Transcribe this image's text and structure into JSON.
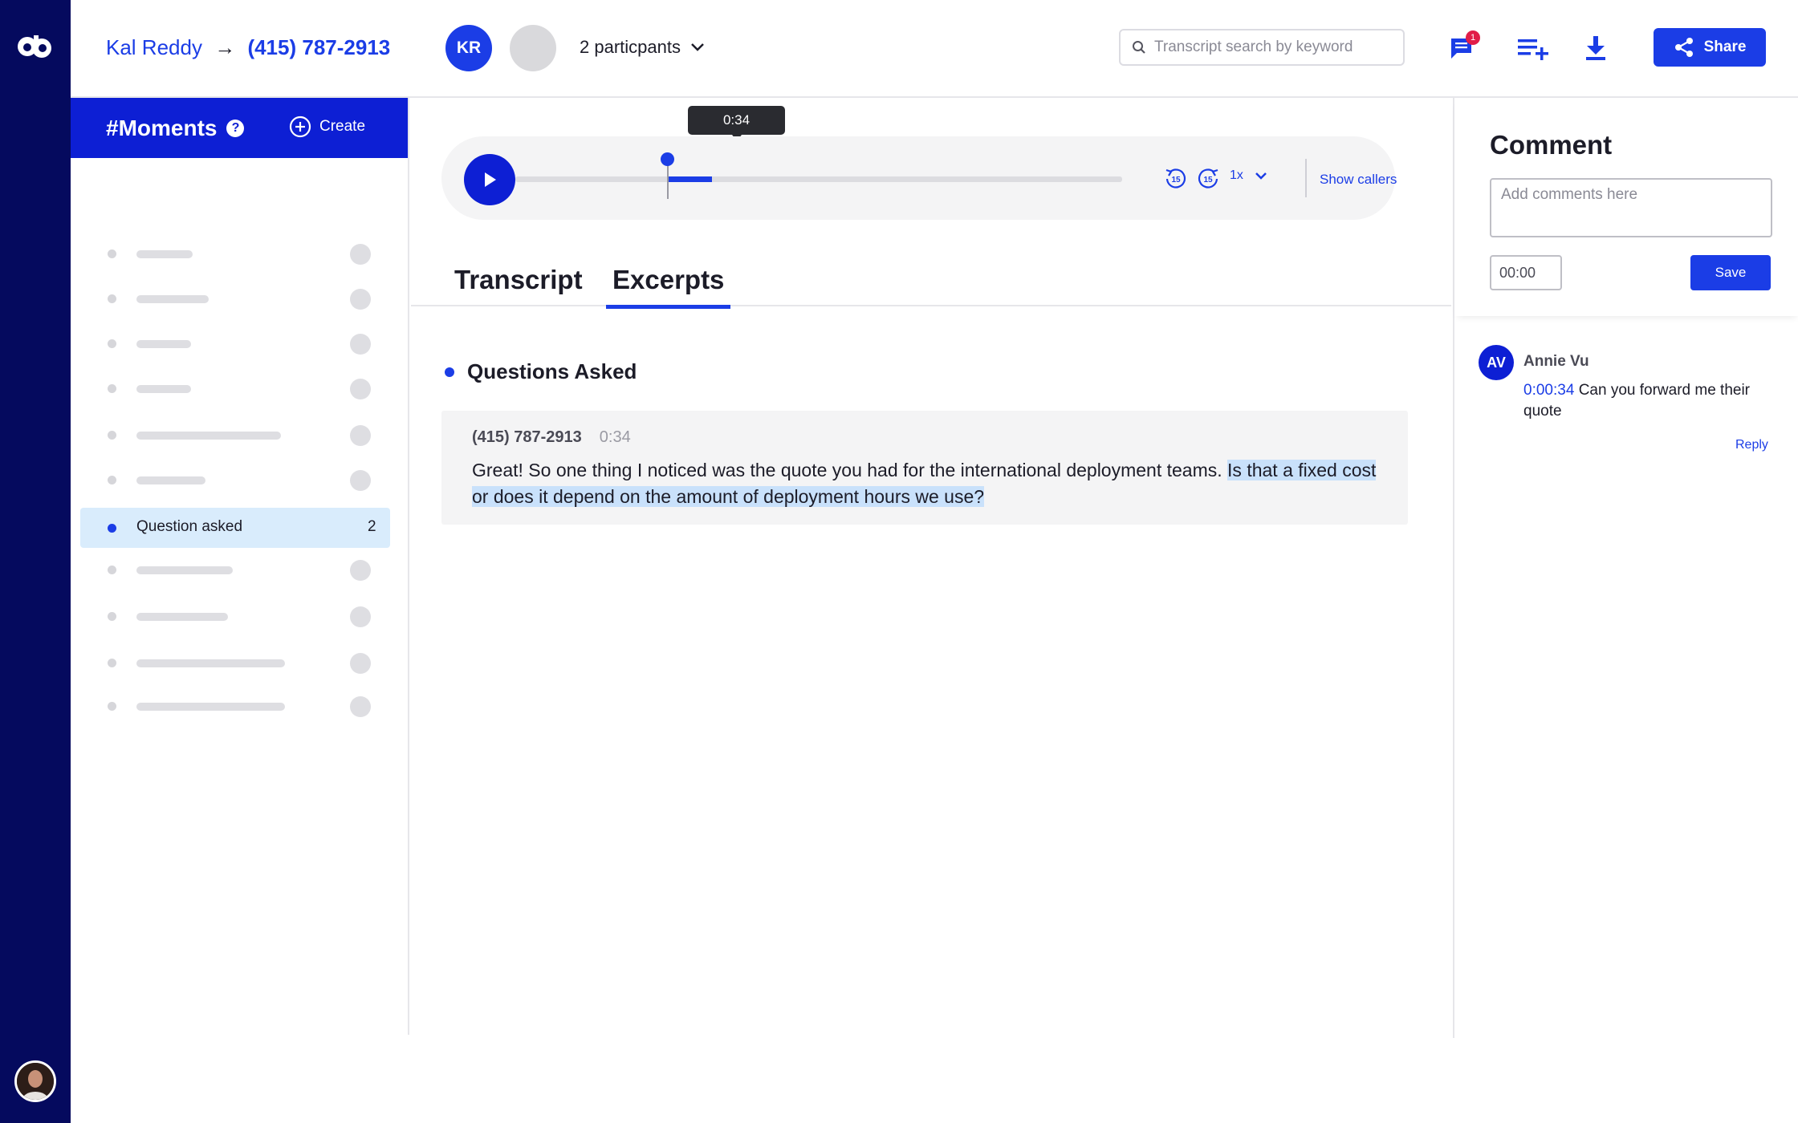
{
  "header": {
    "caller_name": "Kal Reddy",
    "arrow": "→",
    "callee_phone": "(415) 787-2913",
    "participant_initials": "KR",
    "participants_label": "2 particpants",
    "search_placeholder": "Transcript search by keyword",
    "comments_badge": "1",
    "share_label": "Share"
  },
  "moments": {
    "title": "#Moments",
    "help_glyph": "?",
    "create_label": "Create",
    "active_item": {
      "label": "Question asked",
      "count": "2"
    }
  },
  "player": {
    "tooltip_time": "0:34",
    "progress_fraction": 0.25,
    "skip_back_label": "15",
    "skip_forward_label": "15",
    "speed": "1x",
    "show_callers_label": "Show callers"
  },
  "tabs": [
    {
      "label": "Transcript",
      "active": false
    },
    {
      "label": "Excerpts",
      "active": true
    }
  ],
  "excerpts": {
    "section_title": "Questions Asked",
    "speaker": "(415) 787-2913",
    "time": "0:34",
    "text_before": "Great! So one thing I noticed was the quote you had for the international deployment teams. ",
    "text_highlight": "Is that a fixed cost or does it depend on the amount of deployment hours we use?"
  },
  "comment": {
    "title": "Comment",
    "placeholder": "Add comments here",
    "time_value": "00:00",
    "save_label": "Save",
    "thread": {
      "initials": "AV",
      "author": "Annie Vu",
      "timestamp": "0:00:34",
      "text": "Can you forward me their quote",
      "reply_label": "Reply"
    }
  },
  "colors": {
    "rail": "#050a5e",
    "accent": "#1b3de6",
    "moments_header": "#0d1fd4",
    "highlight": "#c9e1fb",
    "badge": "#e11d48"
  }
}
